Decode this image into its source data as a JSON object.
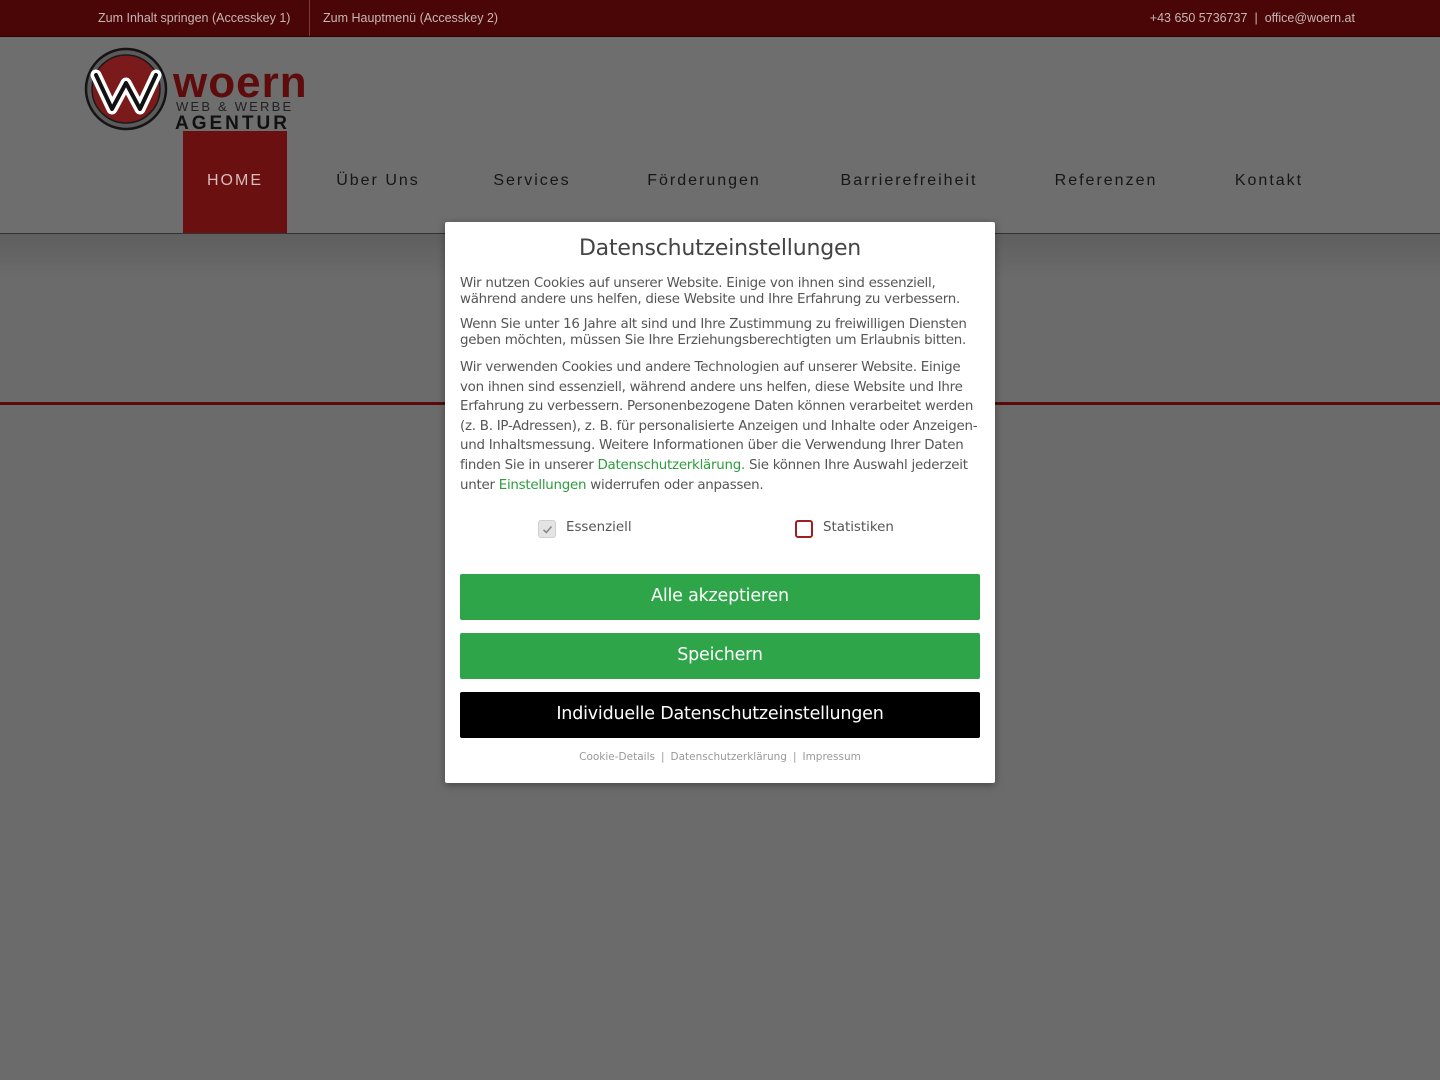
{
  "topbar": {
    "skip_content": "Zum Inhalt springen (Accesskey 1)",
    "skip_menu": "Zum Hauptmenü (Accesskey 2)",
    "phone": "+43 650 5736737",
    "separator": "|",
    "email": "office@woern.at"
  },
  "logo": {
    "name": "woern",
    "line1": "WEB & WERBE",
    "line2": "AGENTUR"
  },
  "nav": {
    "items": [
      {
        "label": "HOME"
      },
      {
        "label": "Über Uns"
      },
      {
        "label": "Services"
      },
      {
        "label": "Förderungen"
      },
      {
        "label": "Barrierefreiheit"
      },
      {
        "label": "Referenzen"
      },
      {
        "label": "Kontakt"
      }
    ]
  },
  "modal": {
    "title": "Datenschutzeinstellungen",
    "p1": "Wir nutzen Cookies auf unserer Website. Einige von ihnen sind essenziell, während andere uns helfen, diese Website und Ihre Erfahrung zu verbessern.",
    "p2": "Wenn Sie unter 16 Jahre alt sind und Ihre Zustimmung zu freiwilligen Diensten geben möchten, müssen Sie Ihre Erziehungsberechtigten um Erlaubnis bitten.",
    "p3_a": "Wir verwenden Cookies und andere Technologien auf unserer Website. Einige von ihnen sind essenziell, während andere uns helfen, diese Website und Ihre Erfahrung zu verbessern. Personenbezogene Daten können verarbeitet werden (z. B. IP-Adressen), z. B. für personalisierte Anzeigen und Inhalte oder Anzeigen- und Inhaltsmessung. Weitere Informationen über die Verwendung Ihrer Daten finden Sie in unserer ",
    "p3_link1": "Datenschutzerklärung.",
    "p3_b": " Sie können Ihre Auswahl jederzeit unter ",
    "p3_link2": "Einstellungen",
    "p3_c": " widerrufen oder anpassen.",
    "check_essential": "Essenziell",
    "check_stats": "Statistiken",
    "btn_accept": "Alle akzeptieren",
    "btn_save": "Speichern",
    "btn_individual": "Individuelle Datenschutzeinstellungen",
    "link_cookie": "Cookie-Details",
    "link_privacy": "Datenschutzerklärung",
    "link_imprint": "Impressum",
    "link_sep": "|"
  },
  "colors": {
    "topbar_bg": "#4a0606",
    "nav_active_bg": "#6a1010",
    "button_green": "#2fa54a",
    "button_black": "#000000",
    "link_green": "#2e9c3d"
  }
}
